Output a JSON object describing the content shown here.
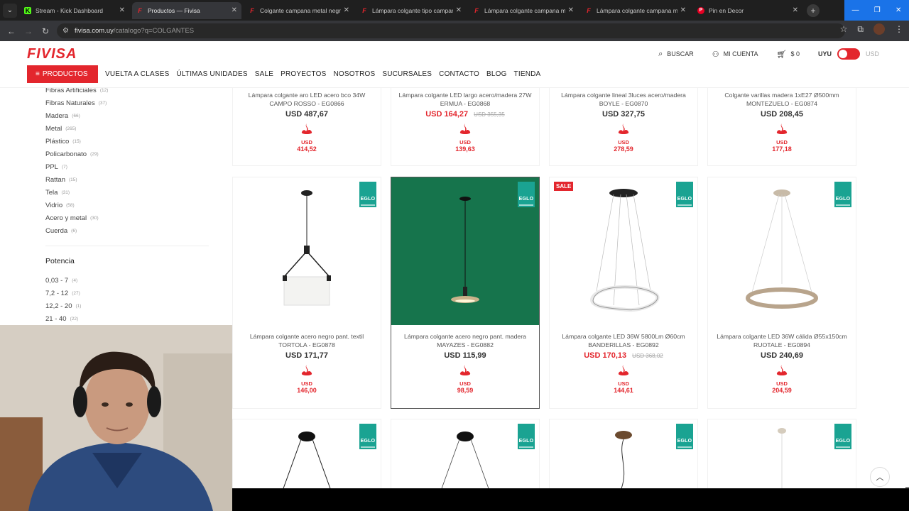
{
  "browser": {
    "tabs": [
      {
        "icon": "kick-icon",
        "favicon": "K",
        "title": "Stream - Kick Dashboard",
        "active": false
      },
      {
        "icon": "fivisa-icon",
        "favicon": "F",
        "title": "Productos — Fivisa",
        "active": true
      },
      {
        "icon": "fivisa-icon",
        "favicon": "F",
        "title": "Colgante campana metal negro",
        "active": false
      },
      {
        "icon": "fivisa-icon",
        "favicon": "F",
        "title": "Lámpara colgante tipo campana",
        "active": false
      },
      {
        "icon": "fivisa-icon",
        "favicon": "F",
        "title": "Lámpara colgante campana me",
        "active": false
      },
      {
        "icon": "fivisa-icon",
        "favicon": "F",
        "title": "Lámpara colgante campana me",
        "active": false
      },
      {
        "icon": "pinterest-icon",
        "favicon": "P",
        "title": "Pin en Decor",
        "active": false
      }
    ],
    "url_host": "fivisa.com.uy",
    "url_path": "/catalogo?q=COLGANTES"
  },
  "site": {
    "logo": "FIVISA",
    "actions": {
      "search": "BUSCAR",
      "account": "MI CUENTA",
      "cart": "$ 0",
      "currency_on": "UYU",
      "currency_off": "USD"
    },
    "products_button": "PRODUCTOS",
    "nav": [
      "VUELTA A CLASES",
      "ÚLTIMAS UNIDADES",
      "SALE",
      "PROYECTOS",
      "NOSOTROS",
      "SUCURSALES",
      "CONTACTO",
      "BLOG",
      "TIENDA"
    ]
  },
  "sidebar": {
    "materials": [
      {
        "label": "Fibras Artificiales",
        "count": "(12)"
      },
      {
        "label": "Fibras Naturales",
        "count": "(37)"
      },
      {
        "label": "Madera",
        "count": "(66)"
      },
      {
        "label": "Metal",
        "count": "(265)"
      },
      {
        "label": "Plástico",
        "count": "(15)"
      },
      {
        "label": "Policarbonato",
        "count": "(29)"
      },
      {
        "label": "PPL",
        "count": "(7)"
      },
      {
        "label": "Rattan",
        "count": "(15)"
      },
      {
        "label": "Tela",
        "count": "(31)"
      },
      {
        "label": "Vidrio",
        "count": "(58)"
      },
      {
        "label": "Acero y metal",
        "count": "(30)"
      },
      {
        "label": "Cuerda",
        "count": "(6)"
      }
    ],
    "power_title": "Potencia",
    "power": [
      {
        "label": "0,03 - 7",
        "count": "(4)"
      },
      {
        "label": "7,2 - 12",
        "count": "(27)"
      },
      {
        "label": "12,2 - 20",
        "count": "(1)"
      },
      {
        "label": "21 - 40",
        "count": "(22)"
      }
    ]
  },
  "products_row1": [
    {
      "name": "Lámpara colgante aro LED acero bco 34W CAMPO ROSSO - EG0866",
      "price": "USD 487,67",
      "old": "",
      "bank_cur": "USD",
      "bank_val": "414,52",
      "sale": false
    },
    {
      "name": "Lámpara colgante LED largo acero/madera 27W ERMUA - EG0868",
      "price": "USD 164,27",
      "old": "USD 355,35",
      "bank_cur": "USD",
      "bank_val": "139,63",
      "sale": true
    },
    {
      "name": "Lámpara colgante lineal 3luces acero/madera BOYLE - EG0870",
      "price": "USD 327,75",
      "old": "",
      "bank_cur": "USD",
      "bank_val": "278,59",
      "sale": false
    },
    {
      "name": "Colgante varillas madera 1xE27 Ø500mm MONTEZUELO - EG0874",
      "price": "USD 208,45",
      "old": "",
      "bank_cur": "USD",
      "bank_val": "177,18",
      "sale": false
    }
  ],
  "products_row2": [
    {
      "name": "Lámpara colgante acero negro pant. textil TORTOLA - EG0878",
      "price": "USD 171,77",
      "old": "",
      "bank_cur": "USD",
      "bank_val": "146,00",
      "brand": "EGLO",
      "badge": ""
    },
    {
      "name": "Lámpara colgante acero negro pant. madera MAYAZES - EG0882",
      "price": "USD 115,99",
      "old": "",
      "bank_cur": "USD",
      "bank_val": "98,59",
      "brand": "EGLO",
      "badge": ""
    },
    {
      "name": "Lámpara colgante LED 36W 5800Lm Ø60cm BANDERILLAS - EG0892",
      "price": "USD 170,13",
      "old": "USD 368,02",
      "bank_cur": "USD",
      "bank_val": "144,61",
      "brand": "EGLO",
      "badge": "SALE"
    },
    {
      "name": "Lámpara colgante LED 36W cálida Ø55x150cm RUOTALE - EG0894",
      "price": "USD 240,69",
      "old": "",
      "bank_cur": "USD",
      "bank_val": "204,59",
      "brand": "EGLO",
      "badge": ""
    }
  ],
  "products_row3": [
    {
      "brand": "EGLO"
    },
    {
      "brand": "EGLO"
    },
    {
      "brand": "EGLO"
    },
    {
      "brand": "EGLO"
    }
  ],
  "colors": {
    "brand_red": "#e3262d",
    "eglo_teal": "#1aa392",
    "whatsapp": "#25d366"
  }
}
